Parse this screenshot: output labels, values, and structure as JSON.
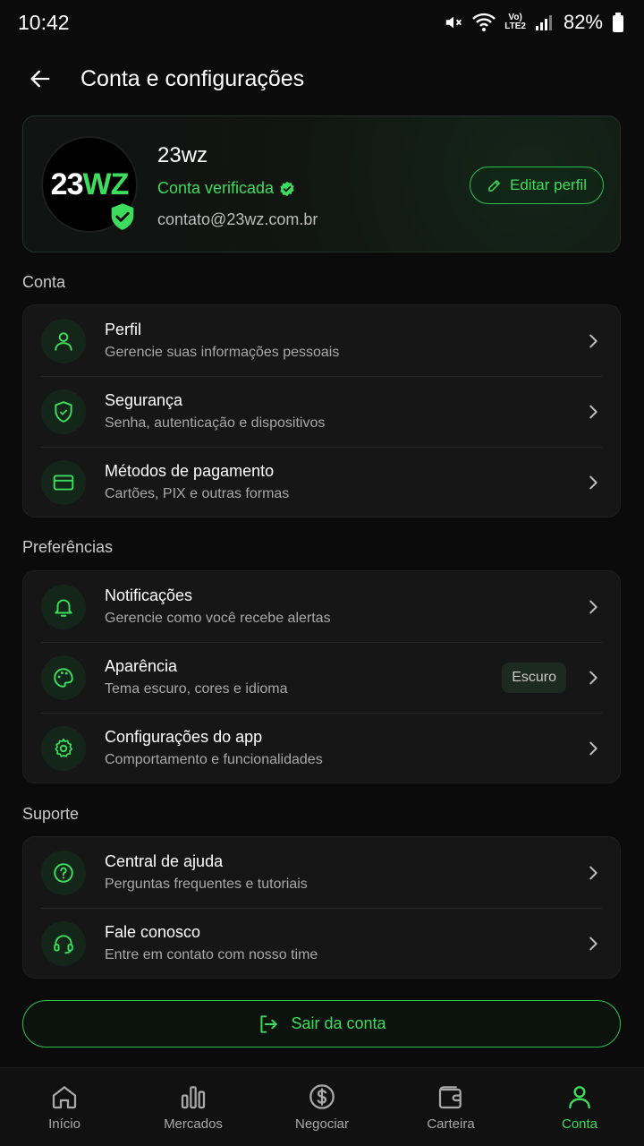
{
  "status_bar": {
    "time": "10:42",
    "battery": "82%",
    "network_top": "Vo)",
    "network_bottom": "LTE2"
  },
  "header": {
    "title": "Conta e configurações"
  },
  "profile": {
    "logo_white": "23",
    "logo_green": "WZ",
    "name": "23wz",
    "verified_label": "Conta verificada",
    "email": "contato@23wz.com.br",
    "edit_label": "Editar perfil"
  },
  "sections": {
    "account": {
      "title": "Conta",
      "items": [
        {
          "title": "Perfil",
          "subtitle": "Gerencie suas informações pessoais",
          "icon": "user-icon"
        },
        {
          "title": "Segurança",
          "subtitle": "Senha, autenticação e dispositivos",
          "icon": "shield-icon"
        },
        {
          "title": "Métodos de pagamento",
          "subtitle": "Cartões, PIX e outras formas",
          "icon": "credit-card-icon"
        }
      ]
    },
    "preferences": {
      "title": "Preferências",
      "items": [
        {
          "title": "Notificações",
          "subtitle": "Gerencie como você recebe alertas",
          "icon": "bell-icon"
        },
        {
          "title": "Aparência",
          "subtitle": "Tema escuro, cores e idioma",
          "icon": "palette-icon",
          "badge": "Escuro"
        },
        {
          "title": "Configurações do app",
          "subtitle": "Comportamento e funcionalidades",
          "icon": "gear-icon"
        }
      ]
    },
    "support": {
      "title": "Suporte",
      "items": [
        {
          "title": "Central de ajuda",
          "subtitle": "Perguntas frequentes e tutoriais",
          "icon": "help-circle-icon"
        },
        {
          "title": "Fale conosco",
          "subtitle": "Entre em contato com nosso time",
          "icon": "headset-icon"
        }
      ]
    }
  },
  "logout_label": "Sair da conta",
  "nav": [
    {
      "label": "Início",
      "icon": "home-icon"
    },
    {
      "label": "Mercados",
      "icon": "bar-chart-icon"
    },
    {
      "label": "Negociar",
      "icon": "dollar-circle-icon"
    },
    {
      "label": "Carteira",
      "icon": "wallet-icon"
    },
    {
      "label": "Conta",
      "icon": "user-icon",
      "active": true
    }
  ],
  "colors": {
    "accent": "#3ddc5c",
    "background": "#0b0b0b",
    "card": "#161616"
  }
}
